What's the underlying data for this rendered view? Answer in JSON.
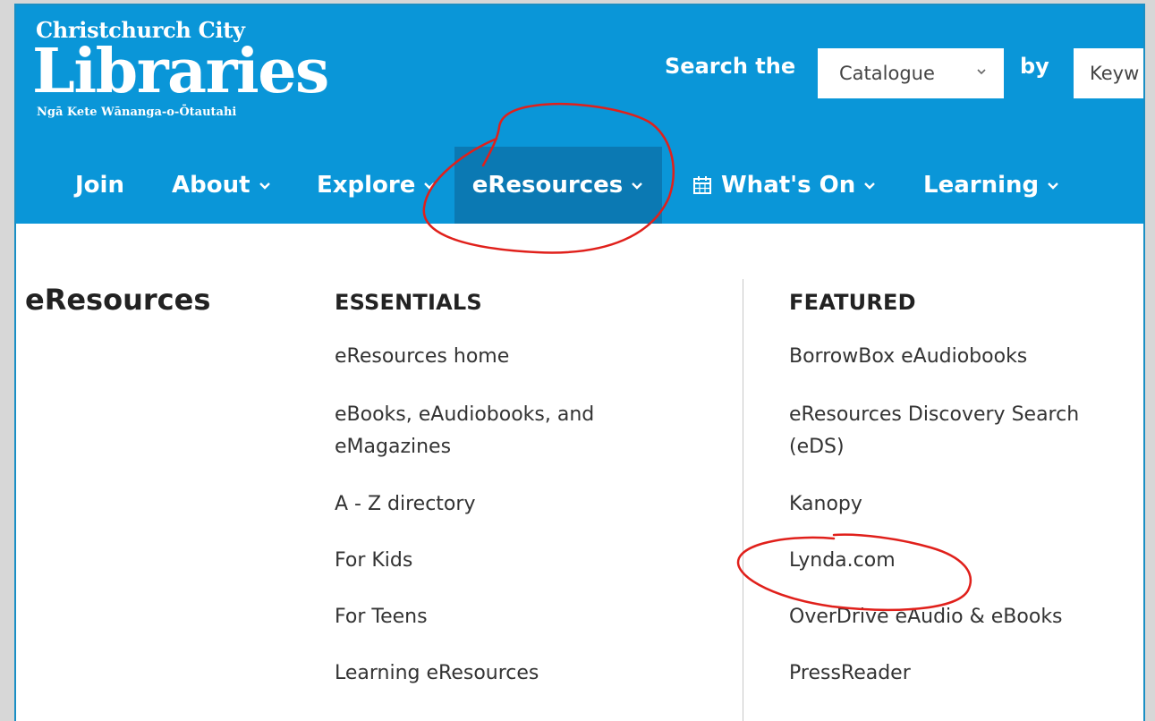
{
  "header": {
    "logo_top": "Christchurch City",
    "logo_main": "Libraries",
    "logo_sub": "Ngā Kete Wānanga-o-Ōtautahi",
    "search_label": "Search the",
    "search_by": "by",
    "search_scope": "Catalogue",
    "search_type": "Keyw"
  },
  "nav": {
    "items": [
      {
        "label": "Join"
      },
      {
        "label": "About"
      },
      {
        "label": "Explore"
      },
      {
        "label": "eResources"
      },
      {
        "label": "What's On"
      },
      {
        "label": "Learning"
      }
    ],
    "active": "eResources"
  },
  "dropdown": {
    "title": "eResources",
    "essentials": {
      "heading": "ESSENTIALS",
      "links": [
        "eResources home",
        "eBooks, eAudiobooks, and eMagazines",
        "A - Z directory",
        "For Kids",
        "For Teens",
        "Learning eResources"
      ]
    },
    "featured": {
      "heading": "FEATURED",
      "links": [
        "BorrowBox eAudiobooks",
        "eResources Discovery Search (eDS)",
        "Kanopy",
        "Lynda.com",
        "OverDrive eAudio & eBooks",
        "PressReader"
      ]
    }
  },
  "colors": {
    "header_bg": "#0a96d8",
    "active_nav_bg": "#0b79b3",
    "annotation_red": "#e0201b"
  },
  "icons": [
    "chevron-down-icon",
    "calendar-icon"
  ]
}
